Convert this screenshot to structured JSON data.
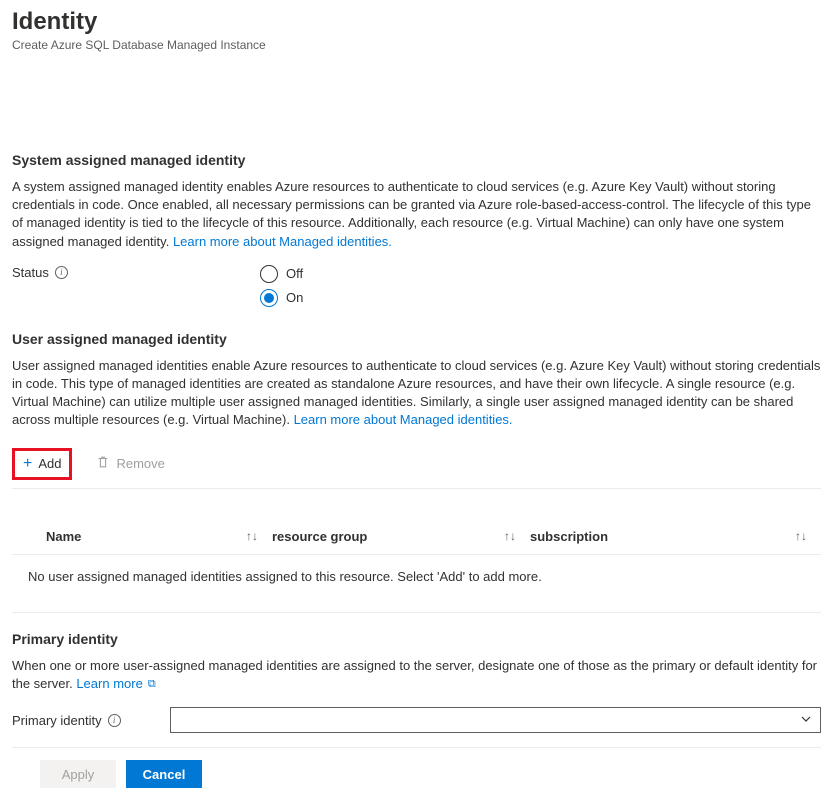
{
  "header": {
    "title": "Identity",
    "subtitle": "Create Azure SQL Database Managed Instance"
  },
  "system_section": {
    "heading": "System assigned managed identity",
    "description": "A system assigned managed identity enables Azure resources to authenticate to cloud services (e.g. Azure Key Vault) without storing credentials in code. Once enabled, all necessary permissions can be granted via Azure role-based-access-control. The lifecycle of this type of managed identity is tied to the lifecycle of this resource. Additionally, each resource (e.g. Virtual Machine) can only have one system assigned managed identity.",
    "learn_more": "Learn more about Managed identities.",
    "status_label": "Status",
    "options": {
      "off": "Off",
      "on": "On"
    },
    "selected": "on"
  },
  "user_section": {
    "heading": "User assigned managed identity",
    "description": "User assigned managed identities enable Azure resources to authenticate to cloud services (e.g. Azure Key Vault) without storing credentials in code. This type of managed identities are created as standalone Azure resources, and have their own lifecycle. A single resource (e.g. Virtual Machine) can utilize multiple user assigned managed identities. Similarly, a single user assigned managed identity can be shared across multiple resources (e.g. Virtual Machine).",
    "learn_more": "Learn more about Managed identities.",
    "add_label": "Add",
    "remove_label": "Remove",
    "columns": {
      "name": "Name",
      "rg": "resource group",
      "sub": "subscription"
    },
    "empty_text": "No user assigned managed identities assigned to this resource. Select 'Add' to add more."
  },
  "primary_section": {
    "heading": "Primary identity",
    "description": "When one or more user-assigned managed identities are assigned to the server, designate one of those as the primary or default identity for the server.",
    "learn_more": "Learn more",
    "select_label": "Primary identity"
  },
  "footer": {
    "apply": "Apply",
    "cancel": "Cancel"
  }
}
